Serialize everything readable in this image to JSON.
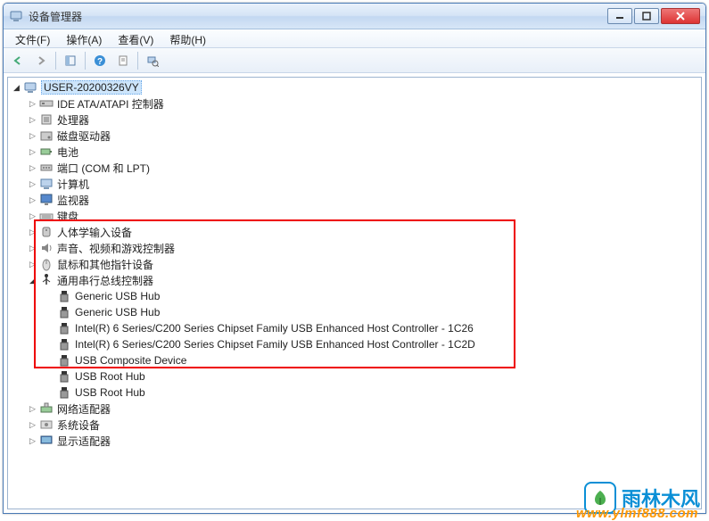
{
  "window": {
    "title": "设备管理器"
  },
  "menu": {
    "file": "文件(F)",
    "action": "操作(A)",
    "view": "查看(V)",
    "help": "帮助(H)"
  },
  "tree": {
    "root": "USER-20200326VY",
    "nodes": [
      {
        "label": "IDE ATA/ATAPI 控制器",
        "icon": "ide"
      },
      {
        "label": "处理器",
        "icon": "cpu"
      },
      {
        "label": "磁盘驱动器",
        "icon": "disk"
      },
      {
        "label": "电池",
        "icon": "battery"
      },
      {
        "label": "端口 (COM 和 LPT)",
        "icon": "port"
      },
      {
        "label": "计算机",
        "icon": "computer"
      },
      {
        "label": "监视器",
        "icon": "monitor"
      },
      {
        "label": "键盘",
        "icon": "keyboard"
      },
      {
        "label": "人体学输入设备",
        "icon": "hid"
      },
      {
        "label": "声音、视频和游戏控制器",
        "icon": "sound"
      },
      {
        "label": "鼠标和其他指针设备",
        "icon": "mouse"
      },
      {
        "label": "通用串行总线控制器",
        "icon": "usb",
        "expanded": true,
        "children": [
          {
            "label": "Generic USB Hub"
          },
          {
            "label": "Generic USB Hub"
          },
          {
            "label": "Intel(R) 6 Series/C200 Series Chipset Family USB Enhanced Host Controller - 1C26"
          },
          {
            "label": "Intel(R) 6 Series/C200 Series Chipset Family USB Enhanced Host Controller - 1C2D"
          },
          {
            "label": "USB Composite Device"
          },
          {
            "label": "USB Root Hub"
          },
          {
            "label": "USB Root Hub"
          }
        ]
      },
      {
        "label": "网络适配器",
        "icon": "network"
      },
      {
        "label": "系统设备",
        "icon": "system"
      },
      {
        "label": "显示适配器",
        "icon": "display"
      }
    ]
  },
  "watermark": {
    "brand": "雨林木风",
    "url": "www.ylmf888.com"
  }
}
